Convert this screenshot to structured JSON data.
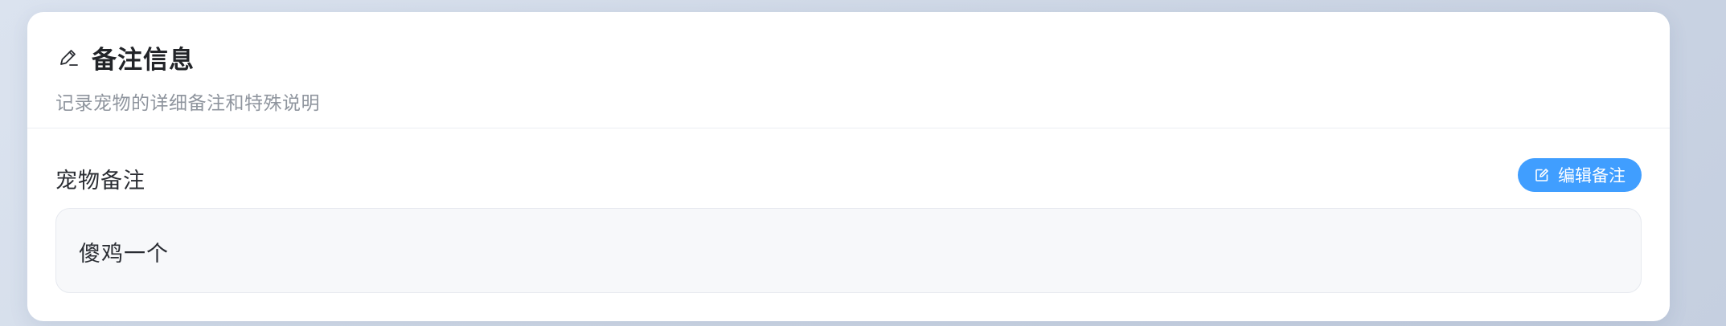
{
  "header": {
    "icon": "pencil-icon",
    "title": "备注信息",
    "subtitle": "记录宠物的详细备注和特殊说明"
  },
  "notes_section": {
    "label": "宠物备注",
    "edit_button": {
      "icon": "edit-icon",
      "label": "编辑备注"
    },
    "note_text": "傻鸡一个"
  },
  "colors": {
    "accent": "#409eff",
    "card_background": "#ffffff",
    "note_background": "#f7f8fa",
    "title_text": "#222428",
    "subtitle_text": "#8f959e"
  }
}
